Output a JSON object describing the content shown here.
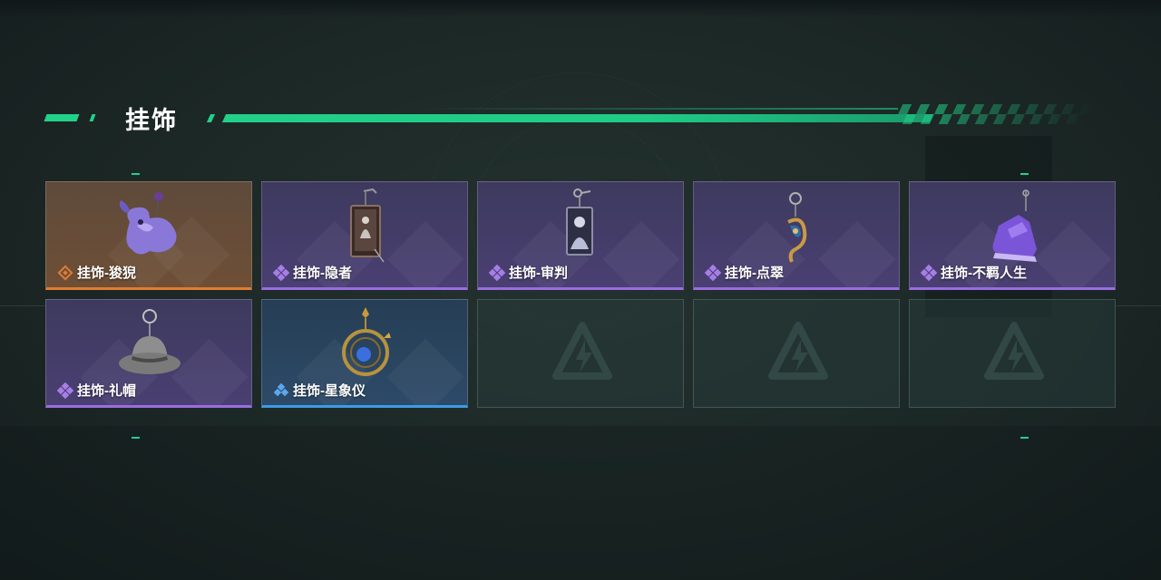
{
  "section": {
    "title": "挂饰"
  },
  "colors": {
    "accent": "#22d08a",
    "rarity_purple": "#9a6ce0",
    "rarity_orange": "#e07c35",
    "rarity_blue": "#3e9be6"
  },
  "items": [
    {
      "name": "挂饰-狻猊",
      "rarity": "orange",
      "icon": "purple-lion-charm-icon"
    },
    {
      "name": "挂饰-隐者",
      "rarity": "purple",
      "icon": "hermit-card-charm-icon"
    },
    {
      "name": "挂饰-审判",
      "rarity": "purple",
      "icon": "judgement-card-charm-icon"
    },
    {
      "name": "挂饰-点翠",
      "rarity": "purple",
      "icon": "phoenix-hairpin-charm-icon"
    },
    {
      "name": "挂饰-不羁人生",
      "rarity": "purple",
      "icon": "sneaker-charm-icon"
    },
    {
      "name": "挂饰-礼帽",
      "rarity": "purple",
      "icon": "top-hat-charm-icon"
    },
    {
      "name": "挂饰-星象仪",
      "rarity": "blue",
      "icon": "astrolabe-charm-icon"
    }
  ],
  "empty_slots": [
    {
      "icon": "empty-slot-logo-icon"
    },
    {
      "icon": "empty-slot-logo-icon"
    },
    {
      "icon": "empty-slot-logo-icon"
    }
  ]
}
